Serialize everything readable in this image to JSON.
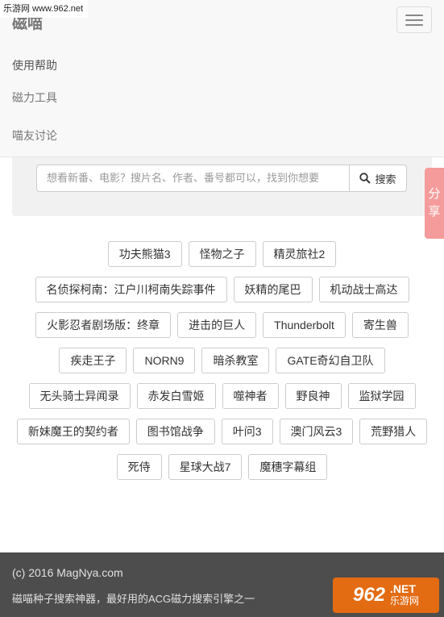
{
  "watermark_top": "乐游网 www.962.net",
  "navbar": {
    "brand": "磁喵",
    "menu": [
      "使用帮助",
      "磁力工具",
      "喵友讨论"
    ]
  },
  "search": {
    "placeholder": "想看新番、电影？搜片名、作者、番号都可以，找到你想要",
    "button_label": "搜索"
  },
  "share": [
    "分",
    "享"
  ],
  "tags": [
    [
      "功夫熊猫3",
      "怪物之子",
      "精灵旅社2"
    ],
    [
      "名侦探柯南：江户川柯南失踪事件",
      "妖精的尾巴",
      "机动战士高达"
    ],
    [
      "火影忍者剧场版：终章",
      "进击的巨人",
      "Thunderbolt",
      "寄生兽"
    ],
    [
      "疾走王子",
      "NORN9",
      "暗杀教室",
      "GATE奇幻自卫队"
    ],
    [
      "无头骑士异闻录",
      "赤发白雪姬",
      "噬神者",
      "野良神",
      "监狱学园"
    ],
    [
      "新妹魔王的契约者",
      "图书馆战争",
      "叶问3",
      "澳门风云3",
      "荒野猎人"
    ],
    [
      "死侍",
      "星球大战7",
      "魔穗字幕组"
    ]
  ],
  "footer": {
    "copyright": "(c) 2016 MagNya.com",
    "tagline": "磁喵种子搜索神器，最好用的ACG磁力搜索引擎之一"
  },
  "watermark_logo": {
    "number": "962",
    "net": ".NET",
    "cn": "乐游网"
  }
}
